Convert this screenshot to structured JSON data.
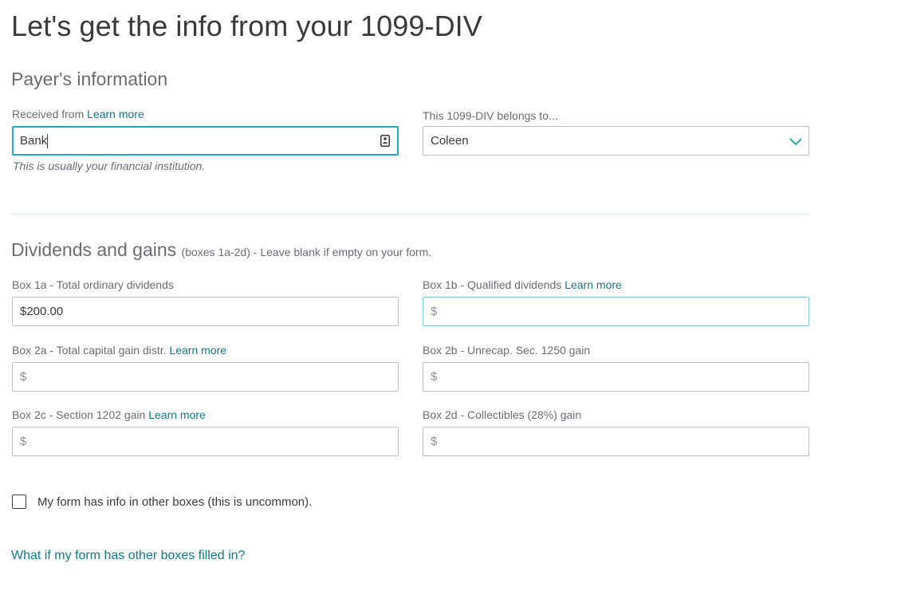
{
  "page": {
    "title": "Let's get the info from your 1099-DIV"
  },
  "payer": {
    "heading": "Payer's information",
    "received_from_label": "Received from",
    "received_from_link": "Learn more",
    "received_from_value": "Bank",
    "received_from_help": "This is usually your financial institution.",
    "belongs_to_label": "This 1099-DIV belongs to...",
    "belongs_to_value": "Coleen"
  },
  "dividends": {
    "heading": "Dividends and gains",
    "heading_sub": "(boxes 1a-2d) - Leave blank if empty on your form.",
    "box1a_label": "Box 1a - Total ordinary dividends",
    "box1a_value": "$200.00",
    "box1b_label": "Box 1b - Qualified dividends",
    "box1b_link": "Learn more",
    "box1b_placeholder": "$",
    "box2a_label": "Box 2a - Total capital gain distr.",
    "box2a_link": "Learn more",
    "box2a_placeholder": "$",
    "box2b_label": "Box 2b - Unrecap. Sec. 1250 gain",
    "box2b_placeholder": "$",
    "box2c_label": "Box 2c - Section 1202 gain",
    "box2c_link": "Learn more",
    "box2c_placeholder": "$",
    "box2d_label": "Box 2d - Collectibles (28%) gain",
    "box2d_placeholder": "$"
  },
  "other_boxes": {
    "checkbox_label": "My form has info in other boxes (this is uncommon).",
    "checked": false,
    "help_link": "What if my form has other boxes filled in?"
  },
  "icons": {
    "received_from_field_icon": "contact-card-icon",
    "belongs_to_dropdown_icon": "chevron-down-icon"
  },
  "colors": {
    "link": "#0d7a8a",
    "focus_border": "#21abb5",
    "text": "#393a3d",
    "muted": "#6b6c72"
  }
}
